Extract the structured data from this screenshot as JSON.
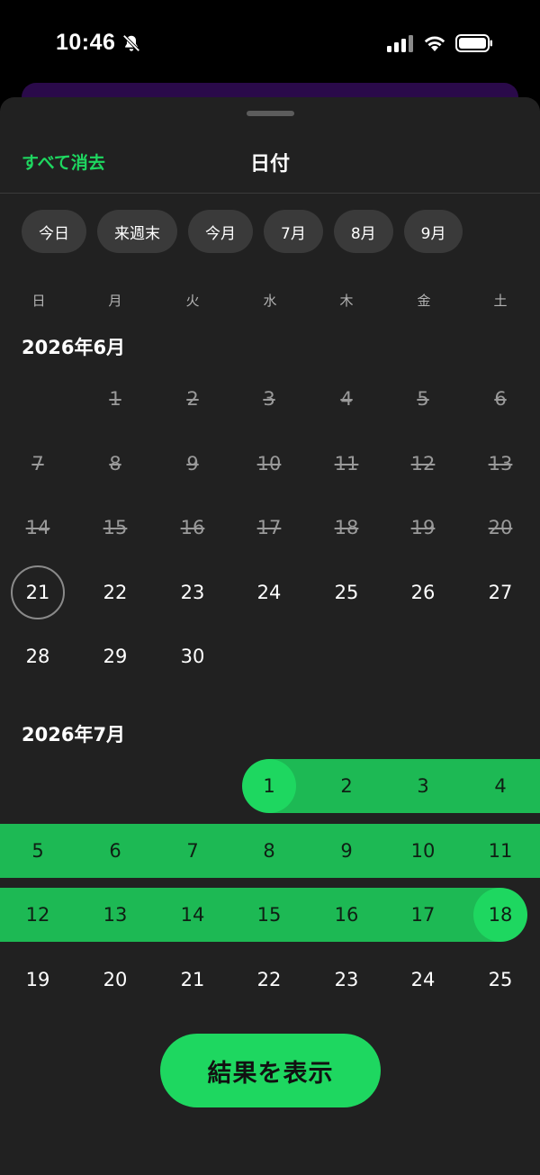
{
  "status_bar": {
    "time": "10:46"
  },
  "sheet": {
    "clear_all": "すべて消去",
    "title": "日付",
    "chips": [
      "今日",
      "来週末",
      "今月",
      "7月",
      "8月",
      "9月"
    ],
    "weekdays": [
      "日",
      "月",
      "火",
      "水",
      "木",
      "金",
      "土"
    ],
    "months": [
      {
        "label": "2026年6月",
        "first_weekday": 1,
        "days": 30,
        "past_through": 20,
        "today": 21
      },
      {
        "label": "2026年7月",
        "first_weekday": 3,
        "days": 25,
        "range_start": 1,
        "range_end": 18
      }
    ],
    "show_results": "結果を表示"
  },
  "colors": {
    "accent": "#1ed760",
    "range": "#1db954",
    "sheet_bg": "#212121",
    "chip_bg": "#3a3a3a"
  },
  "icons": [
    "bell-slash-icon",
    "cellular-signal-icon",
    "wifi-icon",
    "battery-icon"
  ]
}
